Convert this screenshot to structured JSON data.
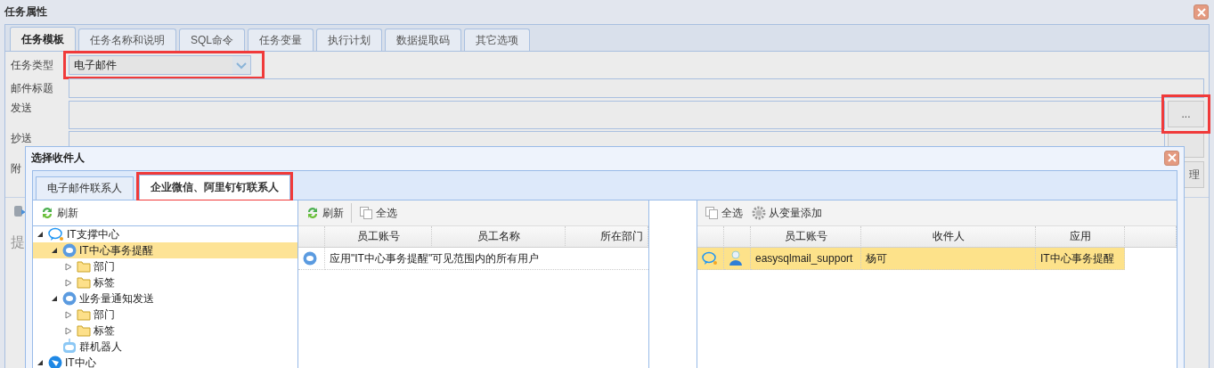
{
  "window": {
    "title": "任务属性"
  },
  "tabs": [
    {
      "label": "任务模板",
      "selected": true
    },
    {
      "label": "任务名称和说明",
      "selected": false
    },
    {
      "label": "SQL命令",
      "selected": false
    },
    {
      "label": "任务变量",
      "selected": false
    },
    {
      "label": "执行计划",
      "selected": false
    },
    {
      "label": "数据提取码",
      "selected": false
    },
    {
      "label": "其它选项",
      "selected": false
    }
  ],
  "form": {
    "task_type": {
      "label": "任务类型",
      "value": "电子邮件",
      "highlighted": true
    },
    "rows": [
      {
        "kind": "text",
        "label": "邮件标题"
      },
      {
        "kind": "picker",
        "label": "发送",
        "button": "...",
        "highlighted": true
      },
      {
        "kind": "picker",
        "label": "抄送"
      },
      {
        "kind": "attach",
        "label": "附",
        "button": "理"
      }
    ]
  },
  "hint": "提",
  "dialog": {
    "title": "选择收件人",
    "tabs": [
      {
        "label": "电子邮件联系人",
        "selected": false,
        "highlighted": false
      },
      {
        "label": "企业微信、阿里钉钉联系人",
        "selected": true,
        "highlighted": true
      }
    ],
    "tree": {
      "refresh": "刷新",
      "items": [
        {
          "label": "IT支撑中心",
          "kind": "chat",
          "expanded": true,
          "selected": false,
          "children": [
            {
              "label": "IT中心事务提醒",
              "kind": "app",
              "expanded": true,
              "selected": true,
              "children": [
                {
                  "label": "部门",
                  "kind": "folder",
                  "expanded": false,
                  "selected": false
                },
                {
                  "label": "标签",
                  "kind": "folder",
                  "expanded": false,
                  "selected": false
                }
              ]
            },
            {
              "label": "业务量通知发送",
              "kind": "app",
              "expanded": true,
              "selected": false,
              "children": [
                {
                  "label": "部门",
                  "kind": "folder",
                  "expanded": false,
                  "selected": false
                },
                {
                  "label": "标签",
                  "kind": "folder",
                  "expanded": false,
                  "selected": false
                }
              ]
            },
            {
              "label": "群机器人",
              "kind": "robot",
              "selected": false
            }
          ]
        },
        {
          "label": "IT中心",
          "kind": "ding",
          "expanded": true,
          "selected": false
        }
      ]
    },
    "members": {
      "refresh": "刷新",
      "select_all": "全选",
      "columns": [
        "员工账号",
        "员工名称",
        "所在部门"
      ],
      "rows": [
        {
          "text": "应用\"IT中心事务提醒\"可见范围内的所有用户"
        }
      ]
    },
    "recipients": {
      "select_all": "全选",
      "add_from_variable": "从变量添加",
      "columns": [
        "员工账号",
        "收件人",
        "应用"
      ],
      "rows": [
        {
          "account": "easysqlmail_support",
          "name": "杨可",
          "app": "IT中心事务提醒",
          "selected": true
        }
      ]
    }
  }
}
